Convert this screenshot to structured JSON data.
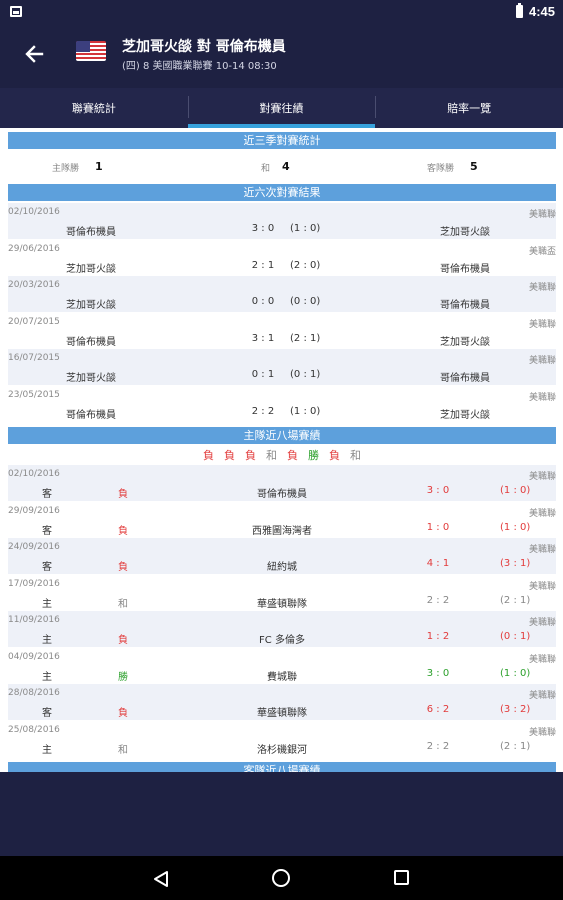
{
  "status": {
    "time": "4:45"
  },
  "header": {
    "title": "芝加哥火燄 對 哥倫布機員",
    "subtitle": "(四) 8  美國職業聯賽  10-14 08:30"
  },
  "tabs": [
    {
      "label": "聯賽統計",
      "active": false
    },
    {
      "label": "對賽往績",
      "active": true
    },
    {
      "label": "賠率一覽",
      "active": false
    }
  ],
  "season_stats": {
    "title": "近三季對賽統計",
    "home_label": "主隊勝",
    "home_value": "1",
    "draw_label": "和",
    "draw_value": "4",
    "away_label": "客隊勝",
    "away_value": "5"
  },
  "h2h": {
    "title": "近六次對賽結果",
    "rows": [
      {
        "date": "02/10/2016",
        "league": "美職聯",
        "home": "哥倫布機員",
        "score": "3 : 0",
        "half": "(1 : 0)",
        "away": "芝加哥火燄"
      },
      {
        "date": "29/06/2016",
        "league": "美職盃",
        "home": "芝加哥火燄",
        "score": "2 : 1",
        "half": "(2 : 0)",
        "away": "哥倫布機員"
      },
      {
        "date": "20/03/2016",
        "league": "美職聯",
        "home": "芝加哥火燄",
        "score": "0 : 0",
        "half": "(0 : 0)",
        "away": "哥倫布機員"
      },
      {
        "date": "20/07/2015",
        "league": "美職聯",
        "home": "哥倫布機員",
        "score": "3 : 1",
        "half": "(2 : 1)",
        "away": "芝加哥火燄"
      },
      {
        "date": "16/07/2015",
        "league": "美職聯",
        "home": "芝加哥火燄",
        "score": "0 : 1",
        "half": "(0 : 1)",
        "away": "哥倫布機員"
      },
      {
        "date": "23/05/2015",
        "league": "美職聯",
        "home": "哥倫布機員",
        "score": "2 : 2",
        "half": "(1 : 0)",
        "away": "芝加哥火燄"
      }
    ]
  },
  "home_recent": {
    "title": "主隊近八場賽績",
    "form": [
      {
        "t": "負",
        "c": "#e23b3b"
      },
      {
        "t": "負",
        "c": "#e23b3b"
      },
      {
        "t": "負",
        "c": "#e23b3b"
      },
      {
        "t": "和",
        "c": "#888888"
      },
      {
        "t": "負",
        "c": "#e23b3b"
      },
      {
        "t": "勝",
        "c": "#2ca02c"
      },
      {
        "t": "負",
        "c": "#e23b3b"
      },
      {
        "t": "和",
        "c": "#888888"
      }
    ],
    "rows": [
      {
        "date": "02/10/2016",
        "league": "美職聯",
        "venue": "客",
        "result": "負",
        "opponent": "哥倫布機員",
        "score": "3 : 0",
        "half": "(1 : 0)",
        "color": "red"
      },
      {
        "date": "29/09/2016",
        "league": "美職聯",
        "venue": "客",
        "result": "負",
        "opponent": "西雅圖海灣者",
        "score": "1 : 0",
        "half": "(1 : 0)",
        "color": "red"
      },
      {
        "date": "24/09/2016",
        "league": "美職聯",
        "venue": "客",
        "result": "負",
        "opponent": "紐約城",
        "score": "4 : 1",
        "half": "(3 : 1)",
        "color": "red"
      },
      {
        "date": "17/09/2016",
        "league": "美職聯",
        "venue": "主",
        "result": "和",
        "opponent": "華盛頓聯隊",
        "score": "2 : 2",
        "half": "(2 : 1)",
        "color": "gray"
      },
      {
        "date": "11/09/2016",
        "league": "美職聯",
        "venue": "主",
        "result": "負",
        "opponent": "FC 多倫多",
        "score": "1 : 2",
        "half": "(0 : 1)",
        "color": "red"
      },
      {
        "date": "04/09/2016",
        "league": "美職聯",
        "venue": "主",
        "result": "勝",
        "opponent": "費城聯",
        "score": "3 : 0",
        "half": "(1 : 0)",
        "color": "green"
      },
      {
        "date": "28/08/2016",
        "league": "美職聯",
        "venue": "客",
        "result": "負",
        "opponent": "華盛頓聯隊",
        "score": "6 : 2",
        "half": "(3 : 2)",
        "color": "red"
      },
      {
        "date": "25/08/2016",
        "league": "美職聯",
        "venue": "主",
        "result": "和",
        "opponent": "洛杉磯銀河",
        "score": "2 : 2",
        "half": "(2 : 1)",
        "color": "gray"
      }
    ]
  },
  "away_recent": {
    "title": "客隊近八場賽績"
  }
}
